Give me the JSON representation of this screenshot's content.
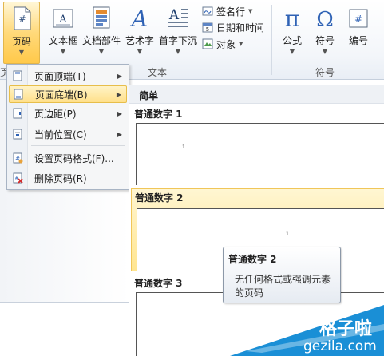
{
  "ribbon": {
    "buttons": [
      {
        "label": "页码",
        "icon": "page-number-icon"
      },
      {
        "label": "文本框",
        "icon": "text-box-icon"
      },
      {
        "label": "文档部件",
        "icon": "quick-parts-icon"
      },
      {
        "label": "艺术字",
        "icon": "wordart-icon"
      },
      {
        "label": "首字下沉",
        "icon": "drop-cap-icon"
      },
      {
        "label": "公式",
        "icon": "pi-icon"
      },
      {
        "label": "符号",
        "icon": "omega-icon"
      },
      {
        "label": "编号",
        "icon": "number-icon"
      }
    ],
    "small_items": [
      {
        "label": "签名行",
        "icon": "signature-line-icon"
      },
      {
        "label": "日期和时间",
        "icon": "date-time-icon"
      },
      {
        "label": "对象",
        "icon": "object-icon"
      }
    ],
    "group_text": "文本",
    "group_symbols": "符号",
    "group_left_partial": "页"
  },
  "menu": {
    "items": [
      {
        "label": "页面顶端(T)",
        "icon": "page-top-icon",
        "has_submenu": true
      },
      {
        "label": "页面底端(B)",
        "icon": "page-bottom-icon",
        "has_submenu": true
      },
      {
        "label": "页边距(P)",
        "icon": "page-margin-icon",
        "has_submenu": true
      },
      {
        "label": "当前位置(C)",
        "icon": "current-position-icon",
        "has_submenu": true
      },
      {
        "label": "设置页码格式(F)...",
        "icon": "format-page-number-icon",
        "has_submenu": false
      },
      {
        "label": "删除页码(R)",
        "icon": "remove-page-number-icon",
        "has_submenu": false
      }
    ]
  },
  "gallery": {
    "header": "简单",
    "items": [
      {
        "name": "普通数字 1",
        "num": "1"
      },
      {
        "name": "普通数字 2",
        "num": "1"
      },
      {
        "name": "普通数字 3",
        "num": ""
      }
    ]
  },
  "tooltip": {
    "title": "普通数字 2",
    "body": "无任何格式或强调元素的页码"
  },
  "watermark": {
    "line1": "格子啦",
    "line2": "gezila.com"
  },
  "colors": {
    "accent": "#ffd97a",
    "highlight_border": "#e2b64c",
    "watermark": "#1a8fd6"
  }
}
